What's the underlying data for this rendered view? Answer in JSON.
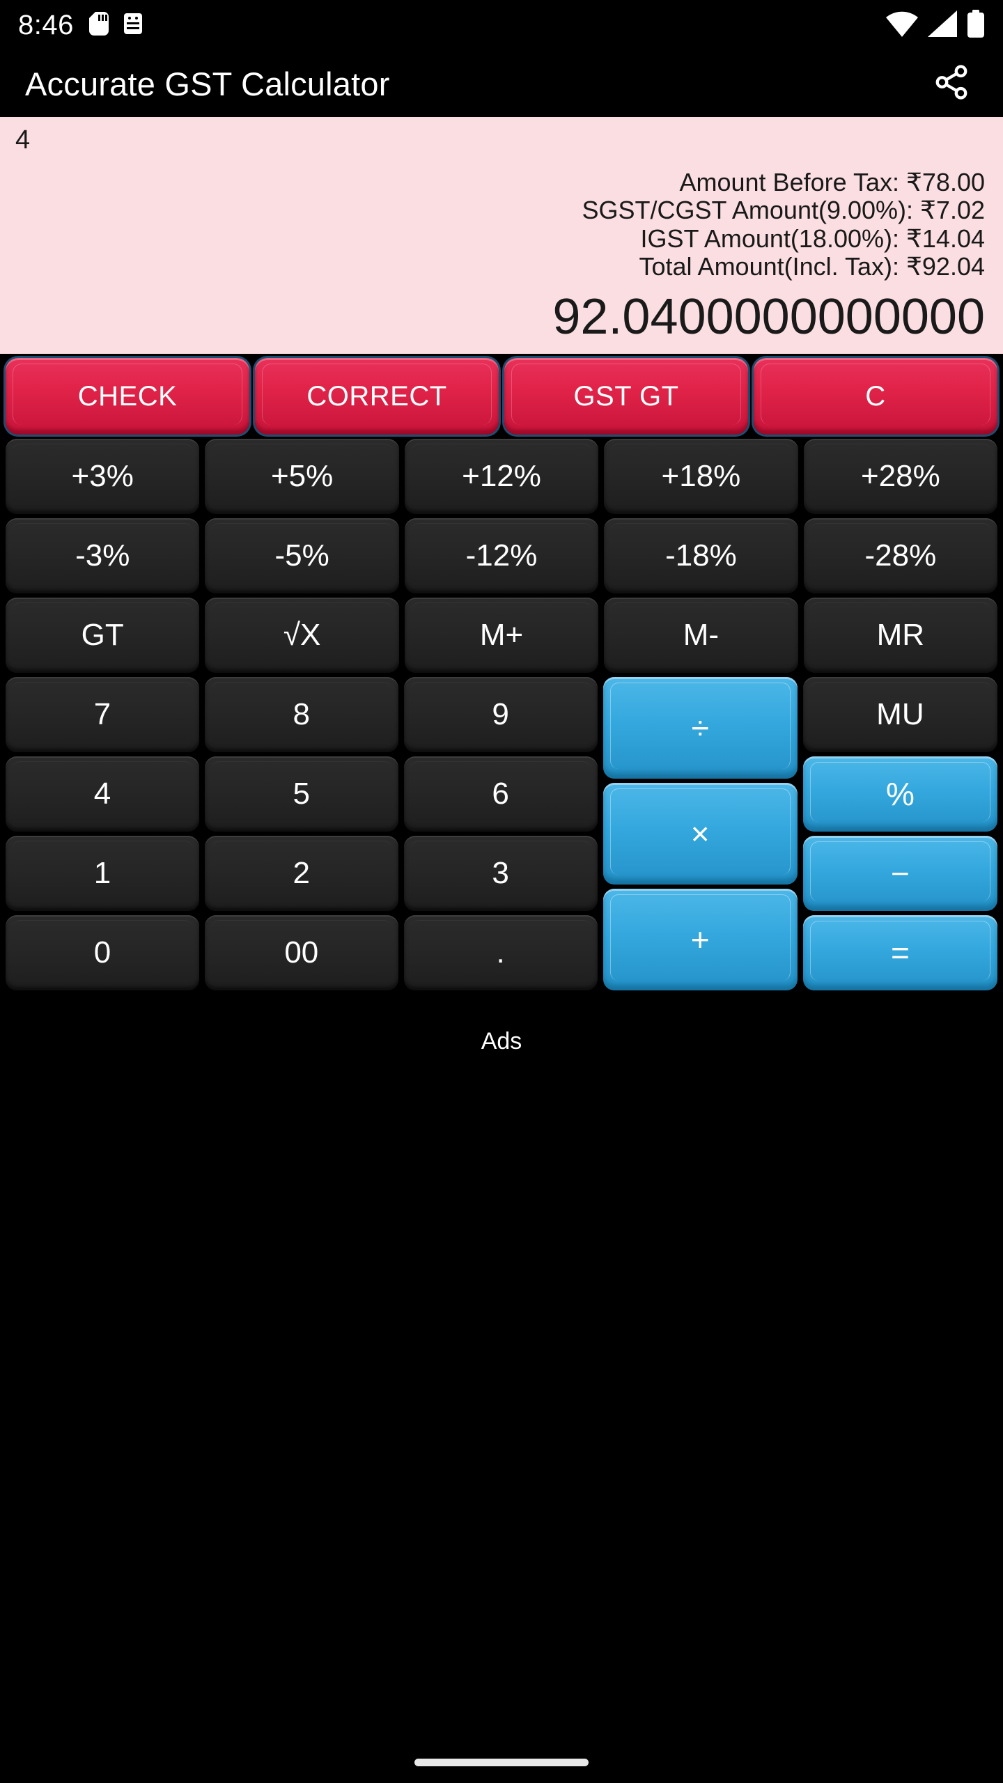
{
  "status_bar": {
    "time": "8:46",
    "left_icons": [
      "sd-card-icon",
      "android-debug-icon"
    ],
    "right_icons": [
      "wifi-icon",
      "signal-icon",
      "battery-icon"
    ]
  },
  "app_bar": {
    "title": "Accurate GST Calculator",
    "share_icon": "share-icon"
  },
  "display": {
    "memo": "4",
    "tax_lines": [
      "Amount Before Tax: ₹78.00",
      "SGST/CGST Amount(9.00%): ₹7.02",
      "IGST Amount(18.00%): ₹14.04",
      "Total Amount(Incl. Tax): ₹92.04"
    ],
    "result": "92.0400000000000",
    "background_color": "#fbdee2"
  },
  "keypad": {
    "function_row": [
      {
        "label": "CHECK",
        "name": "check-button"
      },
      {
        "label": "CORRECT",
        "name": "correct-button"
      },
      {
        "label": "GST GT",
        "name": "gst-gt-button"
      },
      {
        "label": "C",
        "name": "clear-button"
      }
    ],
    "plus_percent_row": [
      {
        "label": "+3%",
        "name": "plus-3-percent-button"
      },
      {
        "label": "+5%",
        "name": "plus-5-percent-button"
      },
      {
        "label": "+12%",
        "name": "plus-12-percent-button"
      },
      {
        "label": "+18%",
        "name": "plus-18-percent-button"
      },
      {
        "label": "+28%",
        "name": "plus-28-percent-button"
      }
    ],
    "minus_percent_row": [
      {
        "label": "-3%",
        "name": "minus-3-percent-button"
      },
      {
        "label": "-5%",
        "name": "minus-5-percent-button"
      },
      {
        "label": "-12%",
        "name": "minus-12-percent-button"
      },
      {
        "label": "-18%",
        "name": "minus-18-percent-button"
      },
      {
        "label": "-28%",
        "name": "minus-28-percent-button"
      }
    ],
    "memory_row": [
      {
        "label": "GT",
        "name": "grand-total-button"
      },
      {
        "label": "√X",
        "name": "square-root-button"
      },
      {
        "label": "M+",
        "name": "memory-plus-button"
      },
      {
        "label": "M-",
        "name": "memory-minus-button"
      },
      {
        "label": "MR",
        "name": "memory-recall-button"
      }
    ],
    "digits_row_1": [
      {
        "label": "7",
        "name": "digit-7-button"
      },
      {
        "label": "8",
        "name": "digit-8-button"
      },
      {
        "label": "9",
        "name": "digit-9-button"
      }
    ],
    "digits_row_2": [
      {
        "label": "4",
        "name": "digit-4-button"
      },
      {
        "label": "5",
        "name": "digit-5-button"
      },
      {
        "label": "6",
        "name": "digit-6-button"
      }
    ],
    "digits_row_3": [
      {
        "label": "1",
        "name": "digit-1-button"
      },
      {
        "label": "2",
        "name": "digit-2-button"
      },
      {
        "label": "3",
        "name": "digit-3-button"
      }
    ],
    "digits_row_4": [
      {
        "label": "0",
        "name": "digit-0-button"
      },
      {
        "label": "00",
        "name": "digit-00-button"
      },
      {
        "label": ".",
        "name": "decimal-point-button"
      }
    ],
    "divide": {
      "label": "÷",
      "name": "divide-button"
    },
    "multiply": {
      "label": "×",
      "name": "multiply-button"
    },
    "plus": {
      "label": "+",
      "name": "plus-button"
    },
    "markup": {
      "label": "MU",
      "name": "markup-button"
    },
    "percent": {
      "label": "%",
      "name": "percent-button"
    },
    "minus": {
      "label": "−",
      "name": "minus-button"
    },
    "equals": {
      "label": "=",
      "name": "equals-button"
    }
  },
  "ads": {
    "label": "Ads"
  },
  "colors": {
    "red_key": "#e12349",
    "blue_key": "#34a8de",
    "dark_key": "#262626",
    "display_bg": "#fbdee2",
    "app_bg": "#000000"
  }
}
